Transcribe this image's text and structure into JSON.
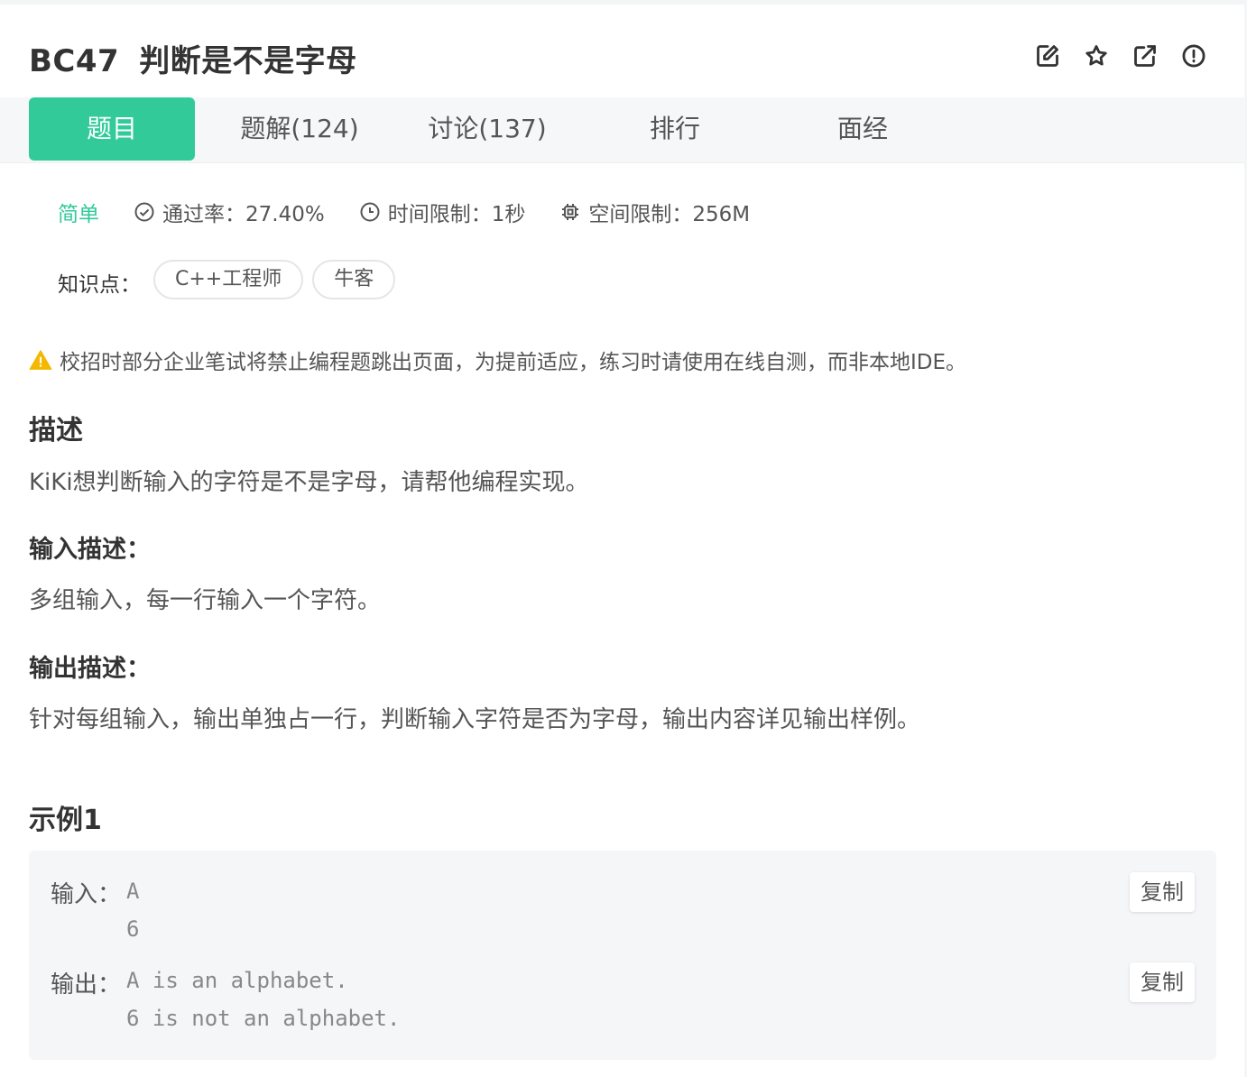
{
  "problem": {
    "code": "BC47",
    "title": "判断是不是字母"
  },
  "actions": [
    {
      "name": "edit-icon"
    },
    {
      "name": "star-icon"
    },
    {
      "name": "share-icon"
    },
    {
      "name": "report-icon"
    }
  ],
  "tabs": [
    {
      "label": "题目",
      "active": true
    },
    {
      "label": "题解(124)"
    },
    {
      "label": "讨论(137)"
    },
    {
      "label": "排行"
    },
    {
      "label": "面经"
    }
  ],
  "meta": {
    "difficulty": "简单",
    "pass_rate": "通过率：27.40%",
    "time_limit": "时间限制：1秒",
    "space_limit": "空间限制：256M"
  },
  "knowledge": {
    "label": "知识点：",
    "tags": [
      "C++工程师",
      "牛客"
    ]
  },
  "warning": "校招时部分企业笔试将禁止编程题跳出页面，为提前适应，练习时请使用在线自测，而非本地IDE。",
  "description": {
    "heading": "描述",
    "text": "KiKi想判断输入的字符是不是字母，请帮他编程实现。"
  },
  "input_desc": {
    "heading": "输入描述：",
    "text": "多组输入，每一行输入一个字符。"
  },
  "output_desc": {
    "heading": "输出描述：",
    "text": "针对每组输入，输出单独占一行，判断输入字符是否为字母，输出内容详见输出样例。"
  },
  "example": {
    "heading": "示例1",
    "input_label": "输入：",
    "input_code": "A\n6",
    "output_label": "输出：",
    "output_code": "A is an alphabet.\n6 is not an alphabet.",
    "copy_label": "复制"
  },
  "colors": {
    "accent": "#32ca99",
    "warning": "#f5b800"
  }
}
